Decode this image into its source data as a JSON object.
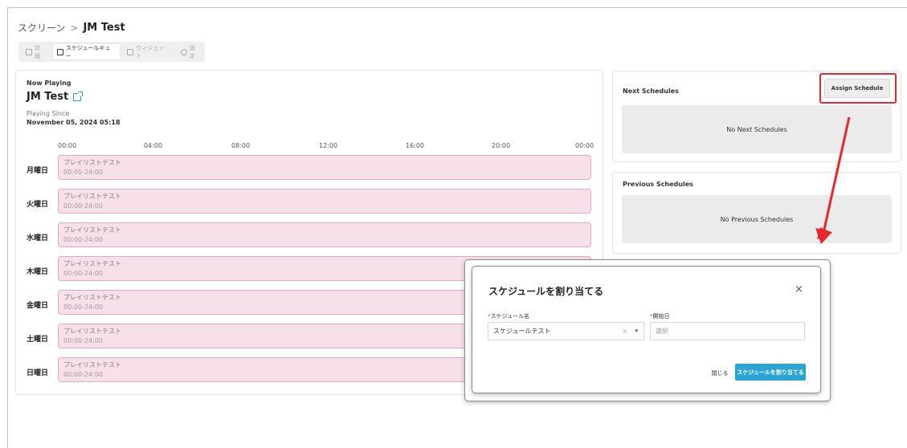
{
  "breadcrumb": {
    "parent": "スクリーン",
    "separator": ">",
    "current": "JM Test"
  },
  "tabs": [
    {
      "label": "詳細",
      "icon": "list-icon",
      "active": false
    },
    {
      "label": "スケジュールキュー",
      "icon": "calendar-icon",
      "active": true
    },
    {
      "label": "ウィジェット",
      "icon": "widget-icon",
      "active": false
    },
    {
      "label": "設定",
      "icon": "gear-icon",
      "active": false
    }
  ],
  "now_playing": {
    "label": "Now Playing",
    "title": "JM Test",
    "playing_since_label": "Playing Since",
    "playing_since_value": "November 05, 2024 05:18"
  },
  "time_axis": [
    "00:00",
    "04:00",
    "08:00",
    "12:00",
    "16:00",
    "20:00",
    "00:00"
  ],
  "days": [
    {
      "day": "月曜日",
      "playlist": "プレイリストテスト",
      "time": "00:00-24:00"
    },
    {
      "day": "火曜日",
      "playlist": "プレイリストテスト",
      "time": "00:00-24:00"
    },
    {
      "day": "水曜日",
      "playlist": "プレイリストテスト",
      "time": "00:00-24:00"
    },
    {
      "day": "木曜日",
      "playlist": "プレイリストテスト",
      "time": "00:00-24:00"
    },
    {
      "day": "金曜日",
      "playlist": "プレイリストテスト",
      "time": "00:00-24:00"
    },
    {
      "day": "土曜日",
      "playlist": "プレイリストテスト",
      "time": "00:00-24:00"
    },
    {
      "day": "日曜日",
      "playlist": "プレイリストテスト",
      "time": "00:00-24:00"
    }
  ],
  "next_schedules": {
    "title": "Next Schedules",
    "assign_button": "Assign Schedule",
    "empty": "No Next Schedules"
  },
  "previous_schedules": {
    "title": "Previous Schedules",
    "empty": "No Previous Schedules"
  },
  "modal": {
    "title": "スケジュールを割り当てる",
    "close_symbol": "×",
    "schedule_name_label": "スケジュール名",
    "schedule_name_value": "スケジュールテスト",
    "start_date_label": "開始日",
    "start_date_placeholder": "選択",
    "required_mark": "*",
    "clear_symbol": "×",
    "caret_symbol": "▾",
    "close_button": "閉じる",
    "submit_button": "スケジュールを割り当てる"
  },
  "colors": {
    "highlight": "#e8262d",
    "primary": "#2aa4d4",
    "playlist_bg": "#f6e0ea",
    "playlist_border": "#e2a8c3"
  }
}
